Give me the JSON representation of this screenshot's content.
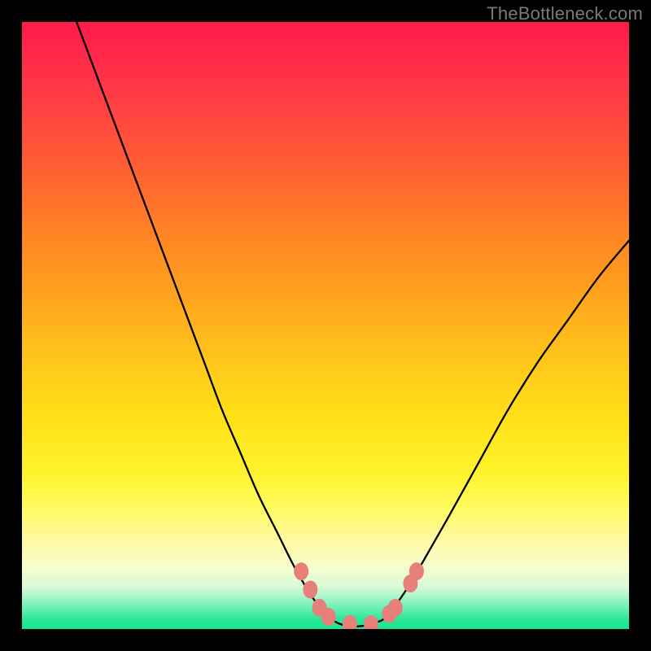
{
  "watermark": "TheBottleneck.com",
  "colors": {
    "frame": "#000000",
    "curve": "#000000",
    "marker": "#e77f7a",
    "gradient_top": "#ff1a4d",
    "gradient_mid": "#ffe018",
    "gradient_bottom": "#1ae58f"
  },
  "chart_data": {
    "type": "line",
    "title": "",
    "xlabel": "",
    "ylabel": "",
    "xlim": [
      0,
      100
    ],
    "ylim": [
      0,
      100
    ],
    "grid": false,
    "legend": false,
    "series": [
      {
        "name": "curve",
        "x": [
          9,
          12,
          15,
          18,
          21,
          24,
          27,
          30,
          33,
          36,
          39,
          42,
          45,
          48,
          50,
          52,
          54,
          56,
          58,
          60,
          63,
          66,
          70,
          75,
          80,
          85,
          90,
          95,
          100
        ],
        "y": [
          100,
          92,
          84,
          76,
          68,
          60,
          52,
          44,
          36,
          29,
          22,
          16,
          10,
          5,
          2.5,
          1,
          0.5,
          0.5,
          1,
          2,
          6,
          11,
          18,
          27,
          36,
          44,
          51,
          58,
          64
        ]
      }
    ],
    "markers": {
      "name": "highlight-points",
      "x": [
        46.0,
        47.5,
        49.0,
        50.5,
        54.0,
        57.5,
        60.5,
        61.5,
        64.0,
        65.0
      ],
      "y": [
        9.5,
        6.5,
        3.5,
        2.0,
        0.8,
        0.8,
        2.5,
        3.5,
        7.5,
        9.5
      ]
    }
  }
}
